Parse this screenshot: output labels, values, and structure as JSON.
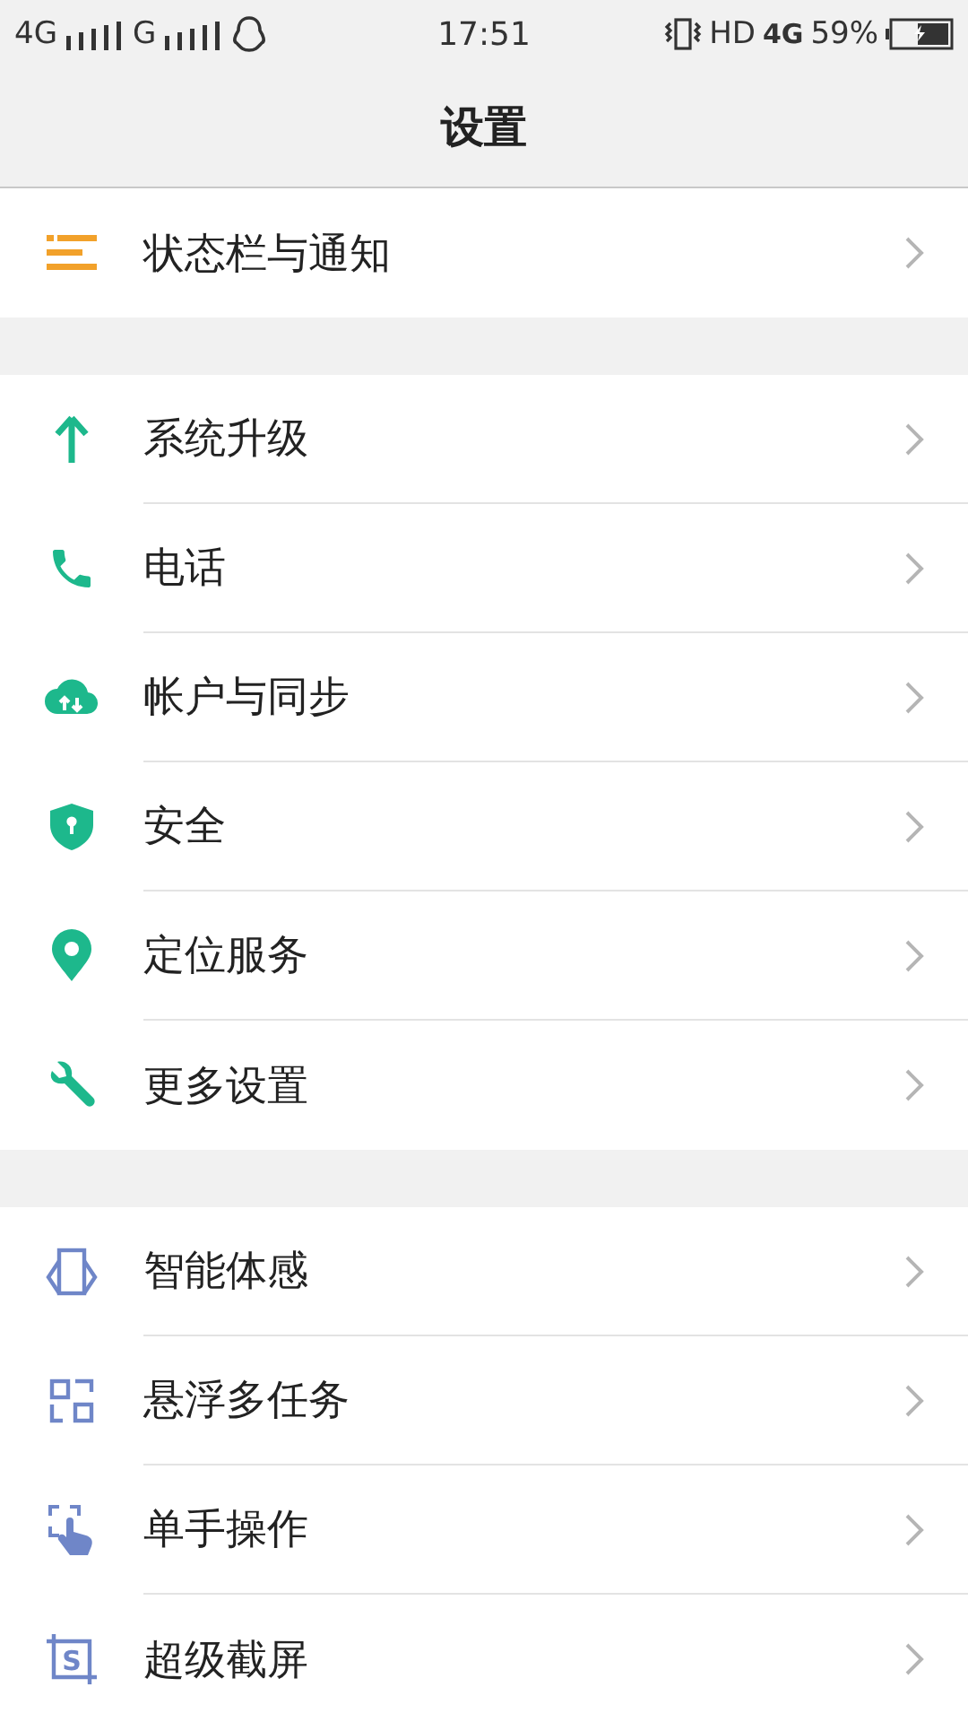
{
  "status_bar": {
    "left": [
      {
        "text": "4G"
      },
      {
        "text": "G"
      }
    ],
    "time": "17:51",
    "hd": "HD",
    "data_network": "4G",
    "battery": "59%"
  },
  "title": "设置",
  "groups": [
    {
      "items": [
        {
          "kind": "list",
          "label": "状态栏与通知"
        }
      ]
    },
    {
      "items": [
        {
          "kind": "arrow",
          "label": "系统升级"
        },
        {
          "kind": "phone",
          "label": "电话"
        },
        {
          "kind": "cloud",
          "label": "帐户与同步"
        },
        {
          "kind": "shield",
          "label": "安全"
        },
        {
          "kind": "pin",
          "label": "定位服务"
        },
        {
          "kind": "wrench",
          "label": "更多设置"
        }
      ]
    },
    {
      "items": [
        {
          "kind": "tilt",
          "label": "智能体感"
        },
        {
          "kind": "float",
          "label": "悬浮多任务"
        },
        {
          "kind": "hand",
          "label": "单手操作"
        },
        {
          "kind": "screenshot",
          "label": "超级截屏",
          "icon_letter": "S"
        }
      ]
    }
  ]
}
